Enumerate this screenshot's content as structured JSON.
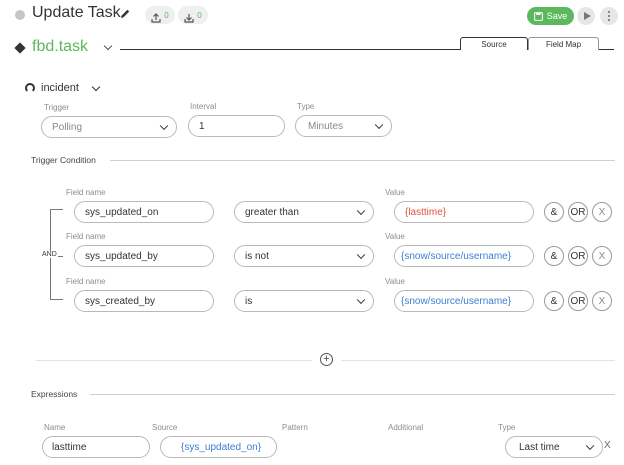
{
  "header": {
    "title": "Update Task",
    "upload_count": "0",
    "download_count": "0",
    "save_label": "Save"
  },
  "task": {
    "name": "fbd.task",
    "tabs": [
      {
        "label": "Source",
        "active": true
      },
      {
        "label": "Field Map",
        "active": false
      }
    ]
  },
  "trigger": {
    "object_name": "incident",
    "trigger_label": "Trigger",
    "trigger_value": "Polling",
    "interval_label": "Interval",
    "interval_value": "1",
    "type_label": "Type",
    "type_value": "Minutes"
  },
  "condition": {
    "title": "Trigger Condition",
    "group_operator": "AND",
    "field_label": "Field name",
    "value_label": "Value",
    "and_label": "&",
    "or_label": "OR",
    "remove_label": "X",
    "rows": [
      {
        "field": "sys_updated_on",
        "operator": "greater than",
        "value": "{lasttime}"
      },
      {
        "field": "sys_updated_by",
        "operator": "is not",
        "value": "{snow/source/username}"
      },
      {
        "field": "sys_created_by",
        "operator": "is",
        "value": "{snow/source/username}"
      }
    ],
    "add_symbol": "+"
  },
  "expressions": {
    "title": "Expressions",
    "columns": {
      "name": "Name",
      "source": "Source",
      "pattern": "Pattern",
      "additional": "Additional",
      "type": "Type"
    },
    "rows": [
      {
        "name": "lasttime",
        "source": "{sys_updated_on}",
        "type": "Last time",
        "remove": "X"
      }
    ]
  },
  "colors": {
    "accent_green": "#5cb85c",
    "variable_red": "#e2533c",
    "variable_blue": "#3d7fd1"
  }
}
